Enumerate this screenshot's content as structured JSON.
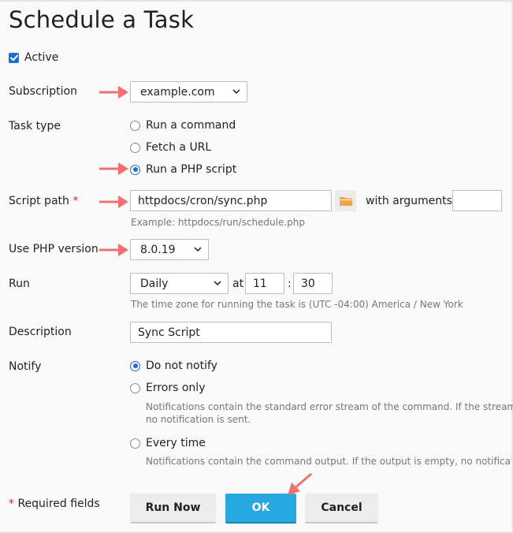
{
  "page": {
    "title": "Schedule a Task"
  },
  "form": {
    "active": {
      "label": "Active",
      "checked": true
    },
    "subscription": {
      "label": "Subscription",
      "value": "example.com"
    },
    "task_type": {
      "label": "Task type",
      "options": [
        {
          "label": "Run a command",
          "selected": false
        },
        {
          "label": "Fetch a URL",
          "selected": false
        },
        {
          "label": "Run a PHP script",
          "selected": true
        }
      ]
    },
    "script_path": {
      "label": "Script path",
      "required_marker": "*",
      "value": "httpdocs/cron/sync.php",
      "example": "Example: httpdocs/run/schedule.php",
      "arguments_label": "with arguments",
      "arguments_value": ""
    },
    "php_version": {
      "label": "Use PHP version",
      "value": "8.0.19"
    },
    "run": {
      "label": "Run",
      "frequency": "Daily",
      "at_label": "at",
      "hour": "11",
      "separator": ":",
      "minute": "30",
      "timezone_hint": "The time zone for running the task is (UTC -04:00) America / New York"
    },
    "description": {
      "label": "Description",
      "value": "Sync Script"
    },
    "notify": {
      "label": "Notify",
      "options": [
        {
          "label": "Do not notify",
          "selected": true,
          "hint": ""
        },
        {
          "label": "Errors only",
          "selected": false,
          "hint_line1": "Notifications contain the standard error stream of the command. If the stream is empty,",
          "hint_line2": "no notification is sent."
        },
        {
          "label": "Every time",
          "selected": false,
          "hint_line1": "Notifications contain the command output. If the output is empty, no notification is sent."
        }
      ]
    }
  },
  "footer": {
    "required_marker": "*",
    "required_text": "Required fields",
    "run_now_label": "Run Now",
    "ok_label": "OK",
    "cancel_label": "Cancel"
  },
  "colors": {
    "accent": "#1a6ed8",
    "primary_button": "#28a8e0",
    "annotation_arrow": "#f07070",
    "folder_icon": "#f5a34a"
  }
}
